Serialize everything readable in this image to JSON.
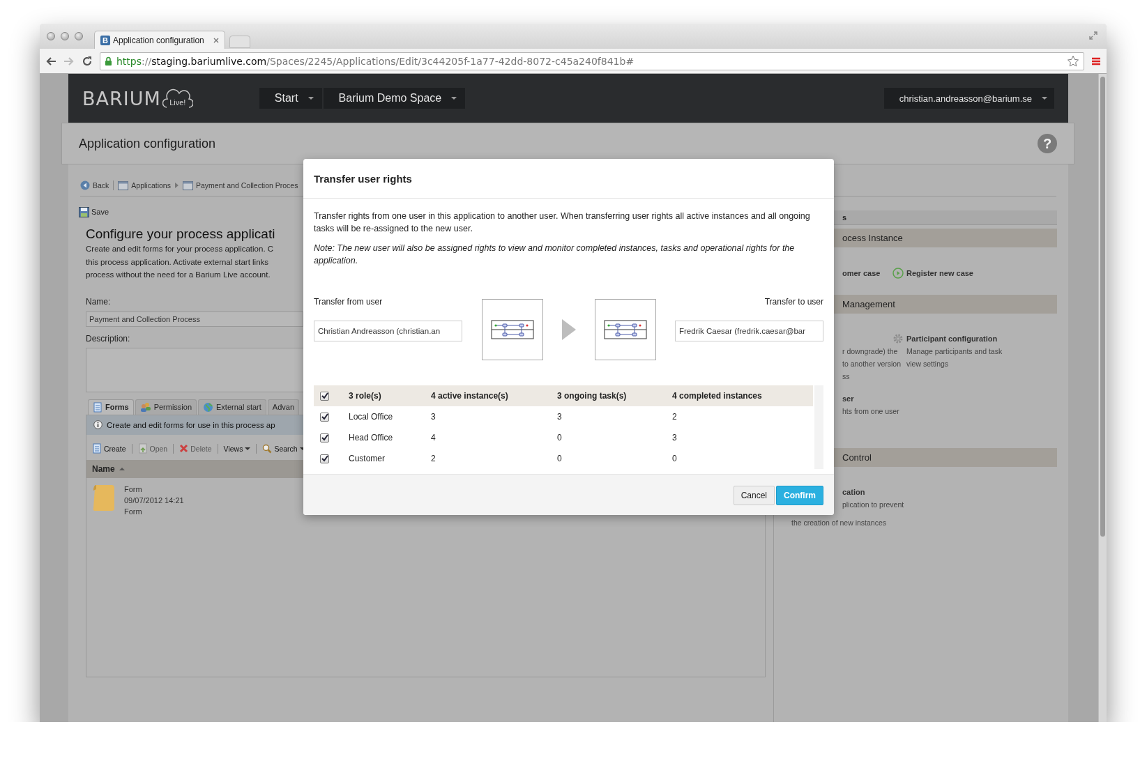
{
  "browser": {
    "tab": {
      "favicon": "B",
      "title": "Application configuration"
    },
    "url": [
      {
        "kind": "scheme",
        "text": "https"
      },
      {
        "kind": "separator",
        "text": "://"
      },
      {
        "kind": "host",
        "text": "staging.bariumlive.com"
      },
      {
        "kind": "path",
        "text": "/Spaces/2245/Applications/Edit/3c44205f-1a77-42dd-8072-c45a240f841b#"
      }
    ]
  },
  "header": {
    "logo": "BARIUM",
    "logo_badge": "Live!",
    "menus": [
      {
        "label": "Start"
      },
      {
        "label": "Barium Demo Space"
      }
    ],
    "user": "christian.andreasson@barium.se"
  },
  "page_title": "Application configuration",
  "help": "?",
  "breadcrumb": [
    {
      "label": "Back"
    },
    {
      "label": "Applications"
    },
    {
      "label": "Payment and Collection Proces"
    }
  ],
  "save": "Save",
  "heading": "Configure your process applicati",
  "intro_lines": [
    "Create and edit forms for your process application. C",
    "this process application. Activate external start links",
    "process without the need for a Barium Live account."
  ],
  "form": {
    "name_label": "Name:",
    "name_value": "Payment and Collection Process",
    "description_label": "Description:"
  },
  "tabs": [
    {
      "label": "Forms",
      "selected": true
    },
    {
      "label": "Permission",
      "selected": false
    },
    {
      "label": "External start",
      "selected": false
    },
    {
      "label": "Advan",
      "selected": false
    }
  ],
  "info": "Create and edit forms for use in this process ap",
  "toolbar": [
    {
      "label": "Create",
      "disabled": false
    },
    {
      "label": "Open",
      "disabled": true
    },
    {
      "label": "Delete",
      "disabled": true
    },
    {
      "label": "Views",
      "disabled": false
    },
    {
      "label": "Search",
      "disabled": false
    }
  ],
  "list": {
    "column": "Name",
    "items": [
      {
        "name": "Form",
        "date": "09/07/2012 14:21",
        "type": "Form"
      }
    ]
  },
  "right_panel": {
    "title": "s",
    "sections": [
      {
        "title": "ocess Instance",
        "columns": [
          [
            {
              "label": "omer case"
            }
          ],
          [
            {
              "label": "Register new case"
            }
          ]
        ]
      },
      {
        "title": "Management",
        "columns": [
          [
            {
              "lines": [
                "r downgrade) the",
                "to another version",
                "ss"
              ]
            },
            {
              "label": "ser",
              "lines": [
                "hts from one user"
              ]
            }
          ],
          [
            {
              "label": "Participant configuration",
              "lines": [
                "Manage participants and task",
                "view settings"
              ]
            }
          ]
        ]
      },
      {
        "title": "Control",
        "columns": [
          [
            {
              "label": "cation",
              "lines": [
                "plication to prevent"
              ]
            }
          ]
        ]
      }
    ],
    "footer_line": "the creation of new instances"
  },
  "modal": {
    "title": "Transfer user rights",
    "description": "Transfer rights from one user in this application to another user. When transferring user rights all active instances and all ongoing tasks will be re-assigned to the new user.",
    "note": "Note: The new user will also be assigned rights to view and monitor completed instances, tasks and operational rights for the application.",
    "from": {
      "label": "Transfer from user",
      "value": "Christian Andreasson (christian.an"
    },
    "to": {
      "label": "Transfer to user",
      "value": "Fredrik Caesar (fredrik.caesar@bar"
    },
    "table": {
      "header": {
        "checked": true,
        "cells": [
          "3 role(s)",
          "4 active instance(s)",
          "3 ongoing task(s)",
          "4 completed instances"
        ]
      },
      "rows": [
        {
          "checked": true,
          "cells": [
            "Local Office",
            "3",
            "3",
            "2"
          ]
        },
        {
          "checked": true,
          "cells": [
            "Head Office",
            "4",
            "0",
            "3"
          ]
        },
        {
          "checked": true,
          "cells": [
            "Customer",
            "2",
            "0",
            "0"
          ]
        }
      ]
    },
    "buttons": [
      {
        "label": "Cancel",
        "kind": "secondary"
      },
      {
        "label": "Confirm",
        "kind": "primary"
      }
    ]
  }
}
